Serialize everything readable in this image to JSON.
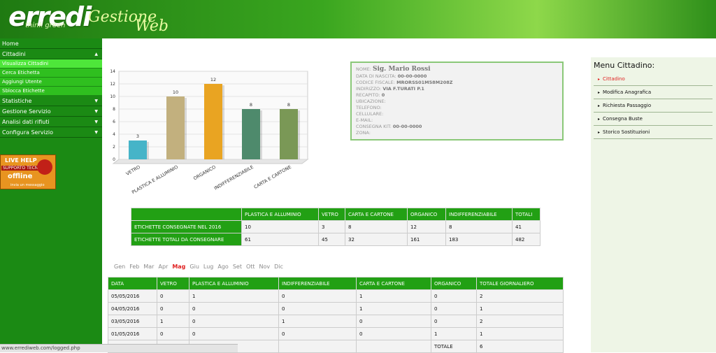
{
  "header": {
    "logo": "erredi",
    "tagline": "think green",
    "title_part1": "Gestione",
    "title_part2": "Web"
  },
  "sidebar": {
    "items": [
      {
        "label": "Home"
      },
      {
        "label": "Cittadini",
        "arrow": "▲"
      },
      {
        "label": "Visualizza Cittadini"
      },
      {
        "label": "Cerca Etichetta"
      },
      {
        "label": "Aggiungi Utente"
      },
      {
        "label": "Sblocca Etichette"
      },
      {
        "label": "Statistiche",
        "arrow": "▼"
      },
      {
        "label": "Gestione Servizio",
        "arrow": "▼"
      },
      {
        "label": "Analisi dati rifiuti",
        "arrow": "▼"
      },
      {
        "label": "Configura Servizio",
        "arrow": "▼"
      }
    ]
  },
  "livehelp": {
    "line1": "LIVE HELP",
    "line2": "SUPPORTO TECNICO",
    "line3": "offline",
    "line4": "invia un messaggio"
  },
  "chart_data": {
    "type": "bar",
    "categories": [
      "VETRO",
      "PLASTICA E ALLUMINIO",
      "ORGANICO",
      "INDIFFERENZIABILE",
      "CARTA E CARTONE"
    ],
    "values": [
      3,
      10,
      12,
      8,
      8
    ],
    "colors": [
      "#46b4c8",
      "#c2b07e",
      "#e9a422",
      "#4e8a6c",
      "#7a9856"
    ],
    "ylim": [
      0,
      14
    ],
    "yticks": [
      "0",
      "2",
      "4",
      "6",
      "8",
      "10",
      "12",
      "14"
    ],
    "grid": true
  },
  "citizen": {
    "name_label": "NOME:",
    "name": "Sig. Mario Rossi",
    "birth_label": "DATA DI NASCITA:",
    "birth": "00-00-0000",
    "cf_label": "CODICE FISCALE:",
    "cf": "MRORSS01M58M208Z",
    "addr_label": "INDIRIZZO:",
    "addr": "VIA F.TURATI P.1",
    "rec_label": "RECAPITO:",
    "rec": "0",
    "ubic_label": "UBICAZIONE:",
    "tel_label": "TELEFONO:",
    "cell_label": "CELLULARE:",
    "email_label": "E-MAIL:",
    "kit_label": "CONSEGNA KIT:",
    "kit": "00-00-0000",
    "zona_label": "ZONA:"
  },
  "right_menu": {
    "title": "Menu Cittadino:",
    "items": [
      "Cittadino",
      "Modifica Anagrafica",
      "Richiesta Passaggio",
      "Consegna Buste",
      "Storico Sostituzioni"
    ]
  },
  "totals": {
    "headers": [
      "",
      "PLASTICA E ALLUMINIO",
      "VETRO",
      "CARTA E CARTONE",
      "ORGANICO",
      "INDIFFERENZIABILE",
      "TOTALI"
    ],
    "rows": [
      [
        "ETICHETTE CONSEGNATE NEL 2016",
        "10",
        "3",
        "8",
        "12",
        "8",
        "41"
      ],
      [
        "ETICHETTE TOTALI DA CONSEGNARE",
        "61",
        "45",
        "32",
        "161",
        "183",
        "482"
      ]
    ]
  },
  "months": [
    "Gen",
    "Feb",
    "Mar",
    "Apr",
    "Mag",
    "Giu",
    "Lug",
    "Ago",
    "Set",
    "Ott",
    "Nov",
    "Dic"
  ],
  "active_month": "Mag",
  "daily": {
    "headers": [
      "DATA",
      "VETRO",
      "PLASTICA E ALLUMINIO",
      "INDIFFERENZIABILE",
      "CARTA E CARTONE",
      "ORGANICO",
      "TOTALE GIORNALIERO"
    ],
    "rows": [
      [
        "05/05/2016",
        "0",
        "1",
        "0",
        "1",
        "0",
        "2"
      ],
      [
        "04/05/2016",
        "0",
        "0",
        "0",
        "1",
        "0",
        "1"
      ],
      [
        "03/05/2016",
        "1",
        "0",
        "1",
        "0",
        "0",
        "2"
      ],
      [
        "01/05/2016",
        "0",
        "0",
        "0",
        "0",
        "1",
        "1"
      ]
    ],
    "total_label": "TOTALE",
    "total_value": "6"
  },
  "status_url": "www.errediweb.com/logged.php"
}
